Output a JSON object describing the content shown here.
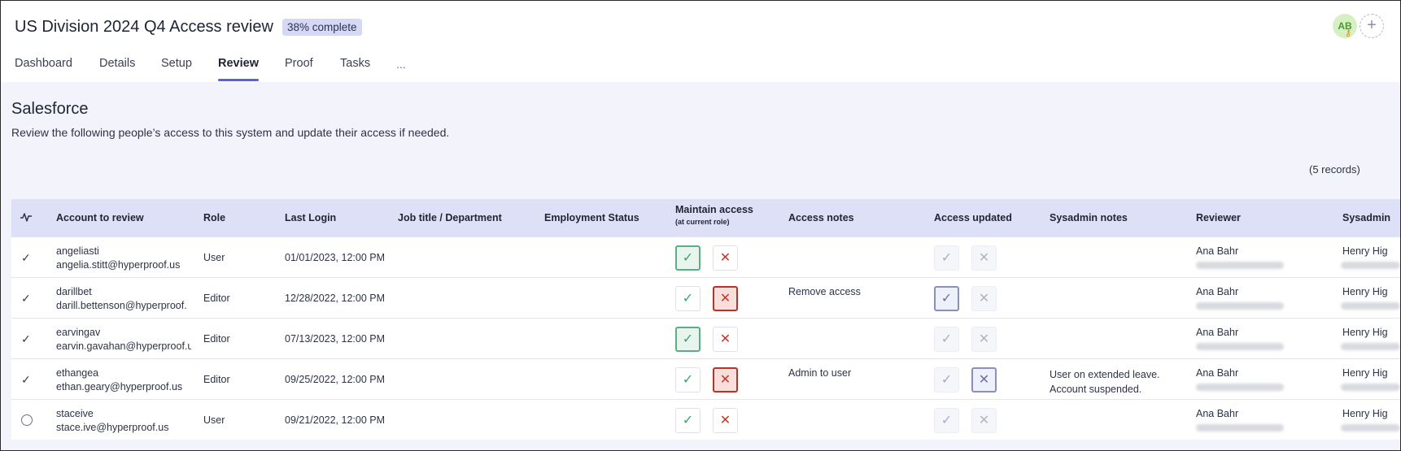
{
  "header": {
    "title": "US Division 2024 Q4 Access review",
    "progress_badge": "38% complete",
    "avatar_initials": "AB",
    "add_label": "+"
  },
  "tabs": [
    {
      "label": "Dashboard",
      "active": false
    },
    {
      "label": "Details",
      "active": false
    },
    {
      "label": "Setup",
      "active": false
    },
    {
      "label": "Review",
      "active": true
    },
    {
      "label": "Proof",
      "active": false
    },
    {
      "label": "Tasks",
      "active": false
    }
  ],
  "tabs_more": "...",
  "system": {
    "name": "Salesforce",
    "description": "Review the following people’s access to this system and update their access if needed.",
    "records": "(5 records)"
  },
  "columns": {
    "account": "Account to review",
    "role": "Role",
    "last_login": "Last Login",
    "job_title": "Job title / Department",
    "employment": "Employment Status",
    "maintain": "Maintain access",
    "maintain_sub": "(at current role)",
    "access_notes": "Access notes",
    "access_updated": "Access updated",
    "sysadmin_notes": "Sysadmin notes",
    "reviewer": "Reviewer",
    "sysadmin": "Sysadmin"
  },
  "rows": [
    {
      "reviewed": true,
      "username": "angeliasti",
      "email": "angelia.stitt@hyperproof.us",
      "role": "User",
      "last_login": "01/01/2023, 12:00 PM",
      "maintain": "keep",
      "access_note": "",
      "updated": "none",
      "sysadmin_note_1": "",
      "sysadmin_note_2": "",
      "reviewer": "Ana Bahr",
      "sysadmin": "Henry Hig"
    },
    {
      "reviewed": true,
      "username": "darillbet",
      "email": "darill.bettenson@hyperproof.",
      "role": "Editor",
      "last_login": "12/28/2022, 12:00 PM",
      "maintain": "revoke",
      "access_note": "Remove access",
      "updated": "yes",
      "sysadmin_note_1": "",
      "sysadmin_note_2": "",
      "reviewer": "Ana Bahr",
      "sysadmin": "Henry Hig"
    },
    {
      "reviewed": true,
      "username": "earvingav",
      "email": "earvin.gavahan@hyperproof.u",
      "role": "Editor",
      "last_login": "07/13/2023, 12:00 PM",
      "maintain": "keep",
      "access_note": "",
      "updated": "none",
      "sysadmin_note_1": "",
      "sysadmin_note_2": "",
      "reviewer": "Ana Bahr",
      "sysadmin": "Henry Hig"
    },
    {
      "reviewed": true,
      "username": "ethangea",
      "email": "ethan.geary@hyperproof.us",
      "role": "Editor",
      "last_login": "09/25/2022, 12:00 PM",
      "maintain": "revoke",
      "access_note": "Admin to user",
      "updated": "no",
      "sysadmin_note_1": "User on extended leave.",
      "sysadmin_note_2": "Account suspended.",
      "reviewer": "Ana Bahr",
      "sysadmin": "Henry Hig"
    },
    {
      "reviewed": false,
      "username": "staceive",
      "email": "stace.ive@hyperproof.us",
      "role": "User",
      "last_login": "09/21/2022, 12:00 PM",
      "maintain": "none",
      "access_note": "",
      "updated": "none",
      "sysadmin_note_1": "",
      "sysadmin_note_2": "",
      "reviewer": "Ana Bahr",
      "sysadmin": "Henry Hig"
    }
  ],
  "icons": {
    "check": "✓",
    "cross": "✕"
  }
}
